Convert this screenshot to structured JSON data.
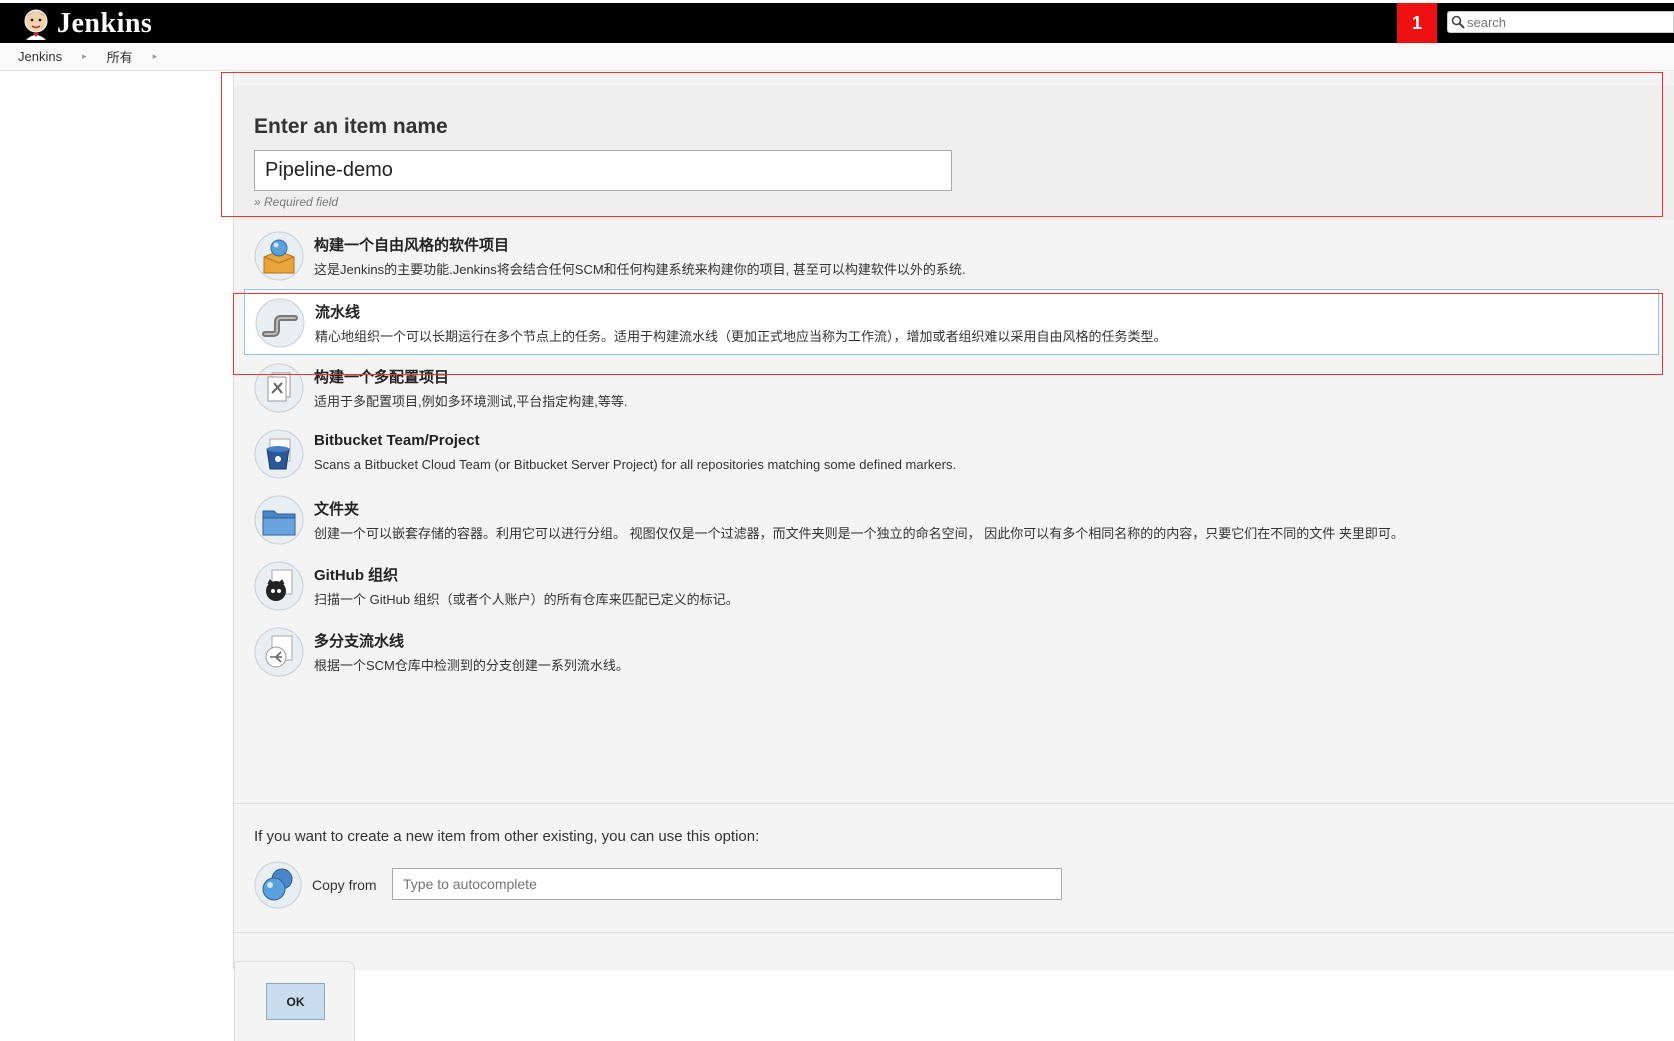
{
  "header": {
    "app_name": "Jenkins",
    "notification_count": "1",
    "search_placeholder": "search",
    "logo_icon": "jenkins-butler-icon",
    "search_icon": "magnifier-icon"
  },
  "breadcrumb": {
    "items": [
      "Jenkins",
      "所有"
    ]
  },
  "item_name": {
    "title": "Enter an item name",
    "value": "Pipeline-demo",
    "required_note": "» Required field"
  },
  "item_types": [
    {
      "label": "构建一个自由风格的软件项目",
      "description": "这是Jenkins的主要功能.Jenkins将会结合任何SCM和任何构建系统来构建你的项目, 甚至可以构建软件以外的系统.",
      "icon": "freestyle-project-icon",
      "selected": false
    },
    {
      "label": "流水线",
      "description": "精心地组织一个可以长期运行在多个节点上的任务。适用于构建流水线（更加正式地应当称为工作流），增加或者组织难以采用自由风格的任务类型。",
      "icon": "pipeline-icon",
      "selected": true
    },
    {
      "label": "构建一个多配置项目",
      "description": "适用于多配置项目,例如多环境测试,平台指定构建,等等.",
      "icon": "multi-configuration-icon",
      "selected": false
    },
    {
      "label": "Bitbucket Team/Project",
      "description": "Scans a Bitbucket Cloud Team (or Bitbucket Server Project) for all repositories matching some defined markers.",
      "icon": "bitbucket-icon",
      "selected": false
    },
    {
      "label": "文件夹",
      "description": "创建一个可以嵌套存储的容器。利用它可以进行分组。 视图仅仅是一个过滤器，而文件夹则是一个独立的命名空间， 因此你可以有多个相同名称的的内容，只要它们在不同的文件 夹里即可。",
      "icon": "folder-icon",
      "selected": false
    },
    {
      "label": "GitHub 组织",
      "description": "扫描一个 GitHub 组织（或者个人账户）的所有仓库来匹配已定义的标记。",
      "icon": "github-organization-icon",
      "selected": false
    },
    {
      "label": "多分支流水线",
      "description": "根据一个SCM仓库中检测到的分支创建一系列流水线。",
      "icon": "multibranch-pipeline-icon",
      "selected": false
    }
  ],
  "copy": {
    "hint": "If you want to create a new item from other existing, you can use this option:",
    "label": "Copy from",
    "placeholder": "Type to autocomplete",
    "icon": "copy-item-icon"
  },
  "ok_label": "OK",
  "colors": {
    "header_bg": "#000000",
    "notification_bg": "#ee1111",
    "highlight_border": "#ee3333",
    "selected_border": "#8fc4e8",
    "ok_bg": "#c9dcee"
  }
}
